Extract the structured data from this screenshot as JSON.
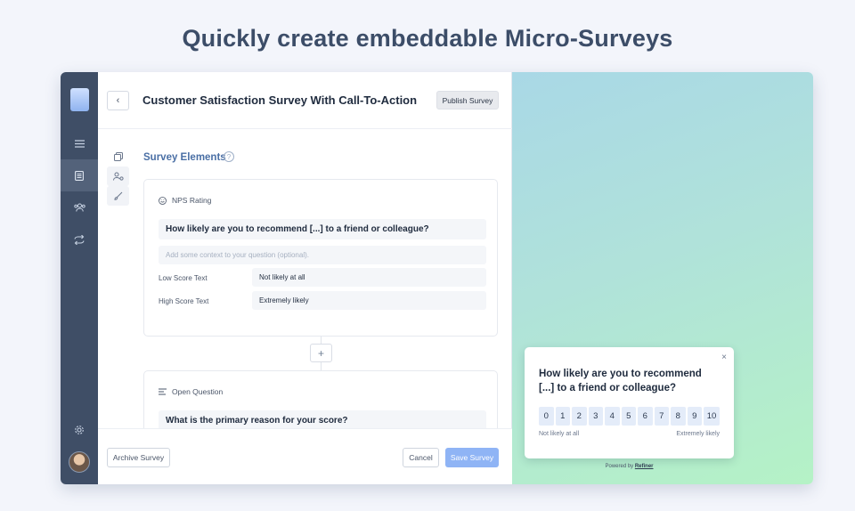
{
  "headline": "Quickly create embeddable Micro-Surveys",
  "nav": {
    "items": [
      {
        "icon": "menu-icon"
      },
      {
        "icon": "survey-icon",
        "active": true
      },
      {
        "icon": "users-icon"
      },
      {
        "icon": "integrations-icon"
      }
    ],
    "settings_icon": "gear-icon"
  },
  "editor": {
    "title": "Customer Satisfaction Survey With Call-To-Action",
    "publish_label": "Publish Survey",
    "section_title": "Survey Elements",
    "elements": [
      {
        "type_label": "NPS Rating",
        "question": "How likely are you to recommend [...] to a friend or colleague?",
        "context_placeholder": "Add some context to your question (optional).",
        "low_label": "Low Score Text",
        "low_value": "Not likely at all",
        "high_label": "High Score Text",
        "high_value": "Extremely likely"
      },
      {
        "type_label": "Open Question",
        "question": "What is the primary reason for your score?"
      }
    ],
    "add_label": "+",
    "archive_label": "Archive Survey",
    "cancel_label": "Cancel",
    "save_label": "Save Survey"
  },
  "preview": {
    "close": "×",
    "question": "How likely are you to recommend [...] to a friend or colleague?",
    "scale": [
      "0",
      "1",
      "2",
      "3",
      "4",
      "5",
      "6",
      "7",
      "8",
      "9",
      "10"
    ],
    "low_text": "Not likely at all",
    "high_text": "Extremely likely",
    "powered_prefix": "Powered by",
    "powered_brand": "Refiner"
  }
}
